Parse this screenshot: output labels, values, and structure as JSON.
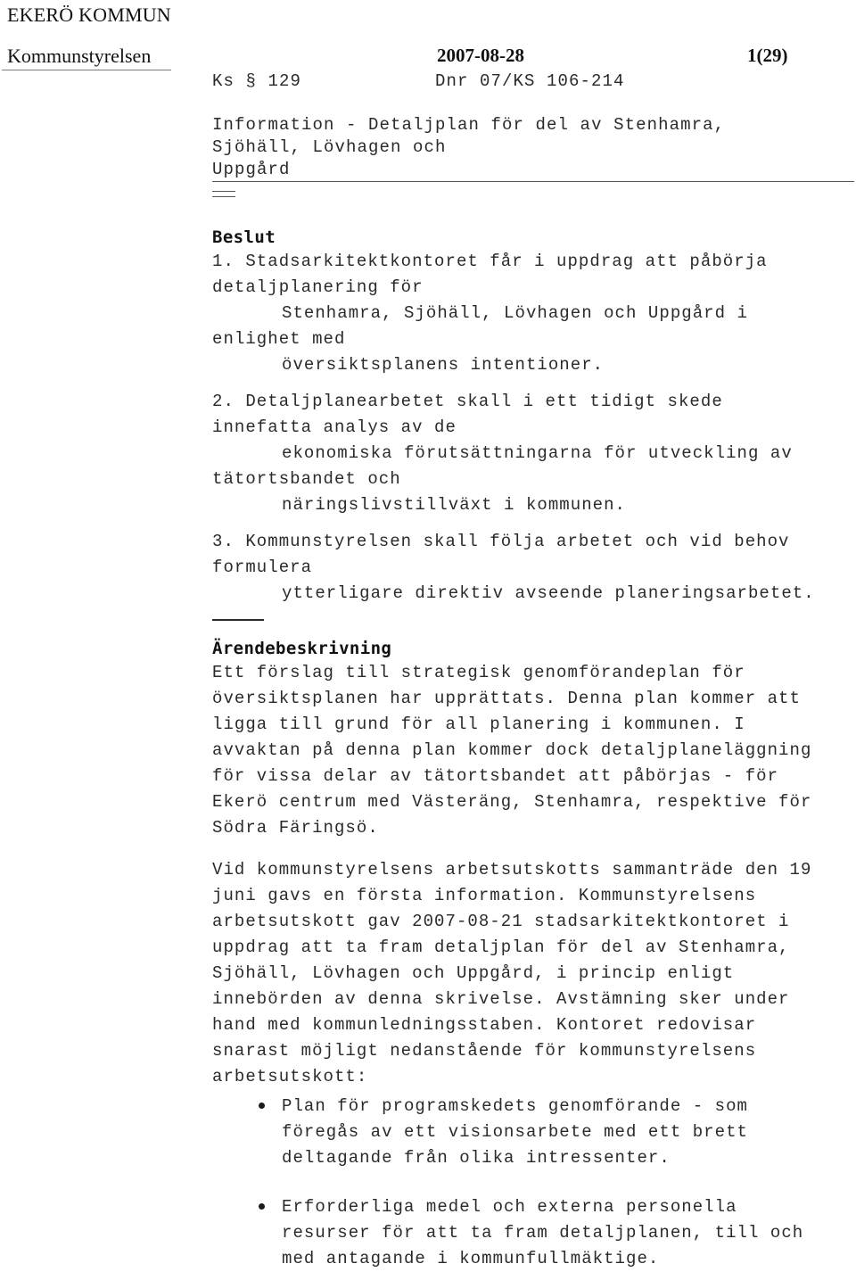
{
  "document": {
    "masthead": "EKERÖ KOMMUN",
    "header": {
      "body": "Kommunstyrelsen",
      "date": "2007-08-28",
      "page": "1(29)"
    },
    "reference": {
      "case": "Ks § 129",
      "dnr": "Dnr 07/KS 106-214"
    },
    "title": {
      "line1": "Information - Detaljplan för del av Stenhamra,",
      "line2": "Sjöhäll, Lövhagen och",
      "line3": "Uppgård"
    },
    "decision": {
      "heading": "Beslut",
      "items": [
        {
          "lead": "1. Stadsarkitektkontoret får i uppdrag att påbörja",
          "second": "detaljplanering för",
          "indented1": "Stenhamra, Sjöhäll, Lövhagen och Uppgård i",
          "third": "enlighet med",
          "indented2": "översiktsplanens intentioner."
        },
        {
          "lead": "2. Detaljplanearbetet skall i ett tidigt skede",
          "second": "innefatta analys av de",
          "indented1": "ekonomiska förutsättningarna för utveckling av",
          "third": "tätortsbandet och",
          "indented2": "näringslivstillväxt i kommunen."
        },
        {
          "lead": "3. Kommunstyrelsen skall följa arbetet och vid behov",
          "second": "formulera",
          "indented1": "ytterligare direktiv avseende planeringsarbetet."
        }
      ]
    },
    "description": {
      "heading": "Ärendebeskrivning",
      "paragraph1": [
        "Ett förslag till strategisk genomförandeplan för",
        "översiktsplanen har upprättats. Denna plan kommer att",
        "ligga till grund för all planering i kommunen. I",
        "avvaktan på denna plan kommer dock detaljplaneläggning",
        "för vissa delar av tätortsbandet att påbörjas - för",
        "Ekerö centrum med Västeräng, Stenhamra, respektive för",
        "Södra Färingsö."
      ],
      "paragraph2": [
        "Vid kommunstyrelsens arbetsutskotts sammanträde den 19",
        "juni gavs en första information. Kommunstyrelsens",
        "arbetsutskott gav 2007-08-21 stadsarkitektkontoret i",
        "uppdrag att ta fram detaljplan för del av Stenhamra,",
        "Sjöhäll, Lövhagen och Uppgård, i princip enligt",
        "innebörden av denna skrivelse. Avstämning sker under",
        "hand med kommunledningsstaben. Kontoret redovisar",
        "snarast möjligt nedanstående för kommunstyrelsens",
        "arbetsutskott:"
      ],
      "bullets": [
        [
          "Plan för programskedets genomförande - som",
          "föregås av ett visionsarbete med ett brett",
          "deltagande från olika intressenter."
        ],
        [
          "Erforderliga medel och externa personella",
          "resurser för att ta fram detaljplanen, till och",
          "med antagande i kommunfullmäktige."
        ]
      ]
    }
  }
}
